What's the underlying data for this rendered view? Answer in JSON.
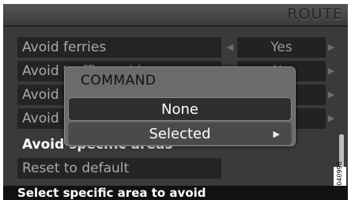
{
  "header": {
    "title": "ROUTE"
  },
  "menu": {
    "items": [
      {
        "label": "Avoid ferries",
        "value": "Yes"
      },
      {
        "label": "Avoid traffic problems",
        "value": "No"
      },
      {
        "label": "Avoid"
      },
      {
        "label": "Avoid"
      },
      {
        "label": "Avoid specific areas",
        "selected": true
      },
      {
        "label": "Reset to default"
      }
    ]
  },
  "dialog": {
    "title": "COMMAND",
    "options": [
      {
        "label": "None"
      },
      {
        "label": "Selected"
      }
    ]
  },
  "status_text": "Select specific area to avoid",
  "image_code": "G040996"
}
